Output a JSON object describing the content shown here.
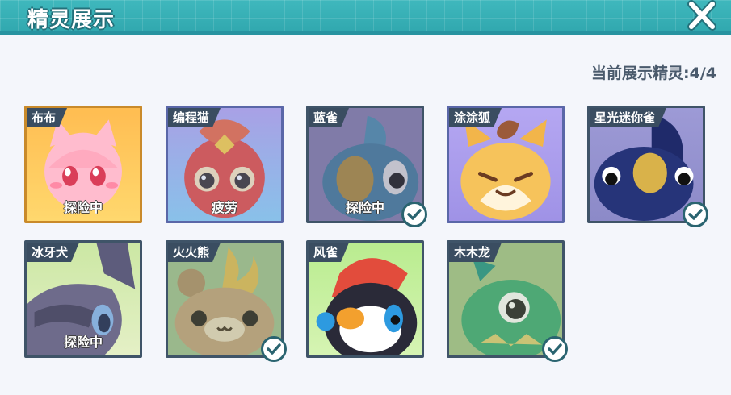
{
  "header": {
    "title": "精灵展示"
  },
  "counter": {
    "label": "当前展示精灵:4/4"
  },
  "sprites": [
    {
      "name": "布布",
      "status": "探险中"
    },
    {
      "name": "编程猫",
      "status": "疲劳"
    },
    {
      "name": "蓝雀",
      "status": "探险中"
    },
    {
      "name": "涂涂狐",
      "status": ""
    },
    {
      "name": "星光迷你雀",
      "status": ""
    },
    {
      "name": "冰牙犬",
      "status": "探险中"
    },
    {
      "name": "火火熊",
      "status": ""
    },
    {
      "name": "风雀",
      "status": ""
    },
    {
      "name": "木木龙",
      "status": ""
    }
  ],
  "icons": {
    "close": "close-icon",
    "check": "checkmark-icon"
  },
  "colors": {
    "header": "#2fa6ad",
    "tag": "#3a4d61",
    "selected_border": "#c98a2a"
  }
}
